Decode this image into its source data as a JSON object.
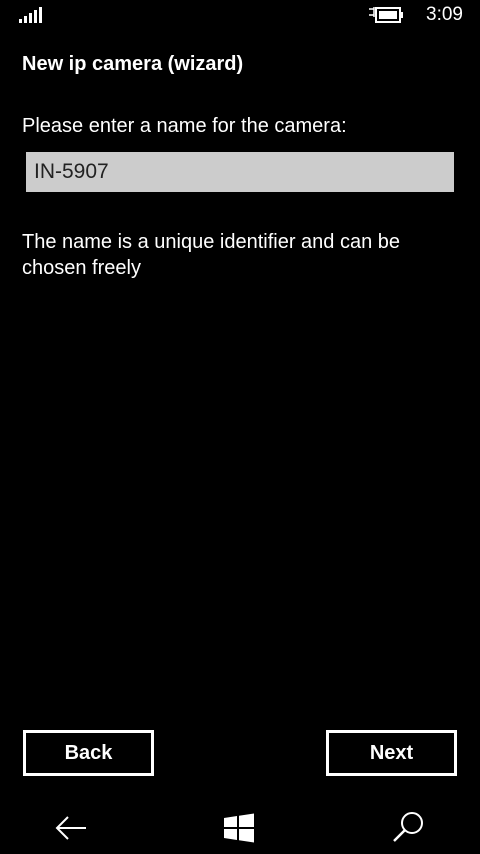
{
  "status_bar": {
    "time": "3:09",
    "signal_icon": "signal-bars-icon",
    "battery_icon": "battery-charging-icon"
  },
  "wizard": {
    "title": "New ip camera (wizard)",
    "prompt": "Please enter a name for the camera:",
    "name_value": "IN-5907",
    "hint": "The name is a unique identifier and can be chosen freely"
  },
  "buttons": {
    "back_label": "Back",
    "next_label": "Next"
  },
  "nav_bar": {
    "back_icon": "arrow-left-icon",
    "home_icon": "windows-logo-icon",
    "search_icon": "search-icon"
  },
  "colors": {
    "background": "#000000",
    "text": "#ffffff",
    "input_background": "#cccccc"
  }
}
